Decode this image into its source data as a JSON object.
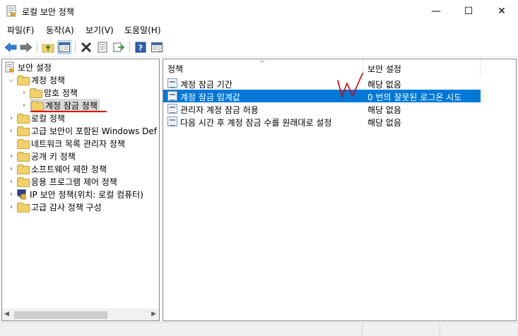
{
  "window": {
    "title": "로컬 보안 정책",
    "minimize_glyph": "—",
    "maximize_glyph": "☐",
    "close_glyph": "✕"
  },
  "menu": {
    "file": "파일(F)",
    "action": "동작(A)",
    "view": "보기(V)",
    "help": "도움말(H)"
  },
  "toolbar": {
    "back_icon": "back-arrow-icon",
    "forward_icon": "forward-arrow-icon",
    "up_icon": "up-folder-icon",
    "show_hide_tree_icon": "console-tree-icon",
    "delete_icon": "delete-x-icon",
    "properties_icon": "properties-icon",
    "export_icon": "export-list-icon",
    "help_icon": "help-icon",
    "show_hide_action_icon": "action-pane-icon"
  },
  "tree": {
    "root": "보안 설정",
    "items": [
      {
        "label": "계정 정책",
        "level": 1,
        "expanded": true
      },
      {
        "label": "암호 정책",
        "level": 2,
        "expanded": false
      },
      {
        "label": "계정 잠금 정책",
        "level": 2,
        "expanded": false,
        "selected": true
      },
      {
        "label": "로컬 정책",
        "level": 1,
        "expanded": false
      },
      {
        "label": "고급 보안이 포함된 Windows Def",
        "level": 1,
        "expanded": false
      },
      {
        "label": "네트워크 목록 관리자 정책",
        "level": 1,
        "expanded": false
      },
      {
        "label": "공개 키 정책",
        "level": 1,
        "expanded": false
      },
      {
        "label": "소프트웨어 제한 정책",
        "level": 1,
        "expanded": false
      },
      {
        "label": "응용 프로그램 제어 정책",
        "level": 1,
        "expanded": false
      },
      {
        "label": "IP 보안 정책(위치: 로컬 컴퓨터)",
        "level": 1,
        "expanded": false
      },
      {
        "label": "고급 감사 정책 구성",
        "level": 1,
        "expanded": false
      }
    ]
  },
  "list": {
    "col_policy": "정책",
    "col_setting": "보안 설정",
    "rows": [
      {
        "policy": "계정 잠금 기간",
        "setting": "해당 없음"
      },
      {
        "policy": "계정 잠금 임계값",
        "setting": "0 번의 잘못된 로그온 시도",
        "selected": true
      },
      {
        "policy": "관리자 계정 잠금 허용",
        "setting": "해당 없음"
      },
      {
        "policy": "다음 시간 후 계정 잠금 수를 원래대로 설정",
        "setting": "해당 없음"
      }
    ]
  },
  "colors": {
    "selection": "#0078d7",
    "annotation_red": "#e00000"
  }
}
